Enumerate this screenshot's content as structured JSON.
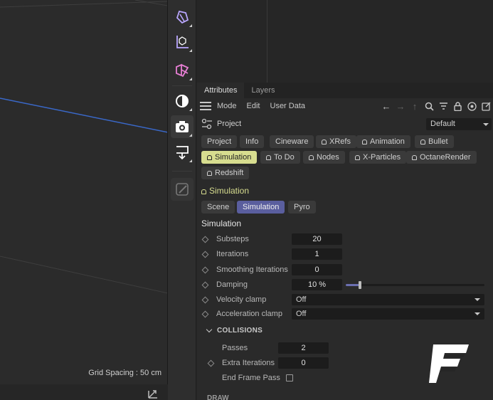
{
  "viewport": {
    "grid_spacing": "Grid Spacing : 50 cm"
  },
  "toolbar": {
    "tools": [
      {
        "icon": "deformer-icon",
        "color": "#b9a6ff"
      },
      {
        "icon": "effector-icon",
        "color": "#b9a6ff"
      },
      {
        "icon": "spline-pen-icon",
        "color": "#e87fd5"
      },
      {
        "icon": "light-icon",
        "color": "#ffffff"
      },
      {
        "icon": "camera-icon",
        "color": "#ffffff"
      },
      {
        "icon": "tag-icon",
        "color": "#ffffff"
      },
      {
        "icon": "sculpt-icon",
        "color": "#777777"
      }
    ]
  },
  "attributes": {
    "tabs": [
      {
        "label": "Attributes",
        "active": true
      },
      {
        "label": "Layers",
        "active": false
      }
    ],
    "menu": [
      "Mode",
      "Edit",
      "User Data"
    ],
    "project_label": "Project",
    "preset": "Default",
    "tab_chips": [
      {
        "label": "Project",
        "locked": false
      },
      {
        "label": "Info",
        "locked": false
      },
      {
        "label": "Cineware",
        "locked": false
      },
      {
        "label": "XRefs",
        "locked": true
      },
      {
        "label": "Animation",
        "locked": true
      },
      {
        "label": "Bullet",
        "locked": true
      },
      {
        "label": "Simulation",
        "locked": true,
        "active": true
      },
      {
        "label": "To Do",
        "locked": true
      },
      {
        "label": "Nodes",
        "locked": true
      },
      {
        "label": "X-Particles",
        "locked": true
      },
      {
        "label": "OctaneRender",
        "locked": true
      },
      {
        "label": "Redshift",
        "locked": true
      }
    ],
    "section_head": "Simulation",
    "sub_tabs": [
      {
        "label": "Scene",
        "active": false
      },
      {
        "label": "Simulation",
        "active": true
      },
      {
        "label": "Pyro",
        "active": false
      }
    ],
    "section_title": "Simulation",
    "params": {
      "substeps": {
        "label": "Substeps",
        "value": "20"
      },
      "iterations": {
        "label": "Iterations",
        "value": "1"
      },
      "smoothing": {
        "label": "Smoothing Iterations",
        "value": "0"
      },
      "damping": {
        "label": "Damping",
        "value": "10 %",
        "fraction": 0.1
      },
      "velocity_clamp": {
        "label": "Velocity clamp",
        "value": "Off"
      },
      "acceleration_clamp": {
        "label": "Acceleration clamp",
        "value": "Off"
      }
    },
    "collisions": {
      "title": "COLLISIONS",
      "passes": {
        "label": "Passes",
        "value": "2"
      },
      "extra_iterations": {
        "label": "Extra Iterations",
        "value": "0"
      },
      "end_frame_pass": {
        "label": "End Frame Pass",
        "checked": false
      }
    },
    "next_section": "DRAW"
  },
  "colors": {
    "active_chip": "#d7dd8f",
    "active_subtab": "#5a5e9e",
    "viewport_line": "#3a68c8"
  }
}
